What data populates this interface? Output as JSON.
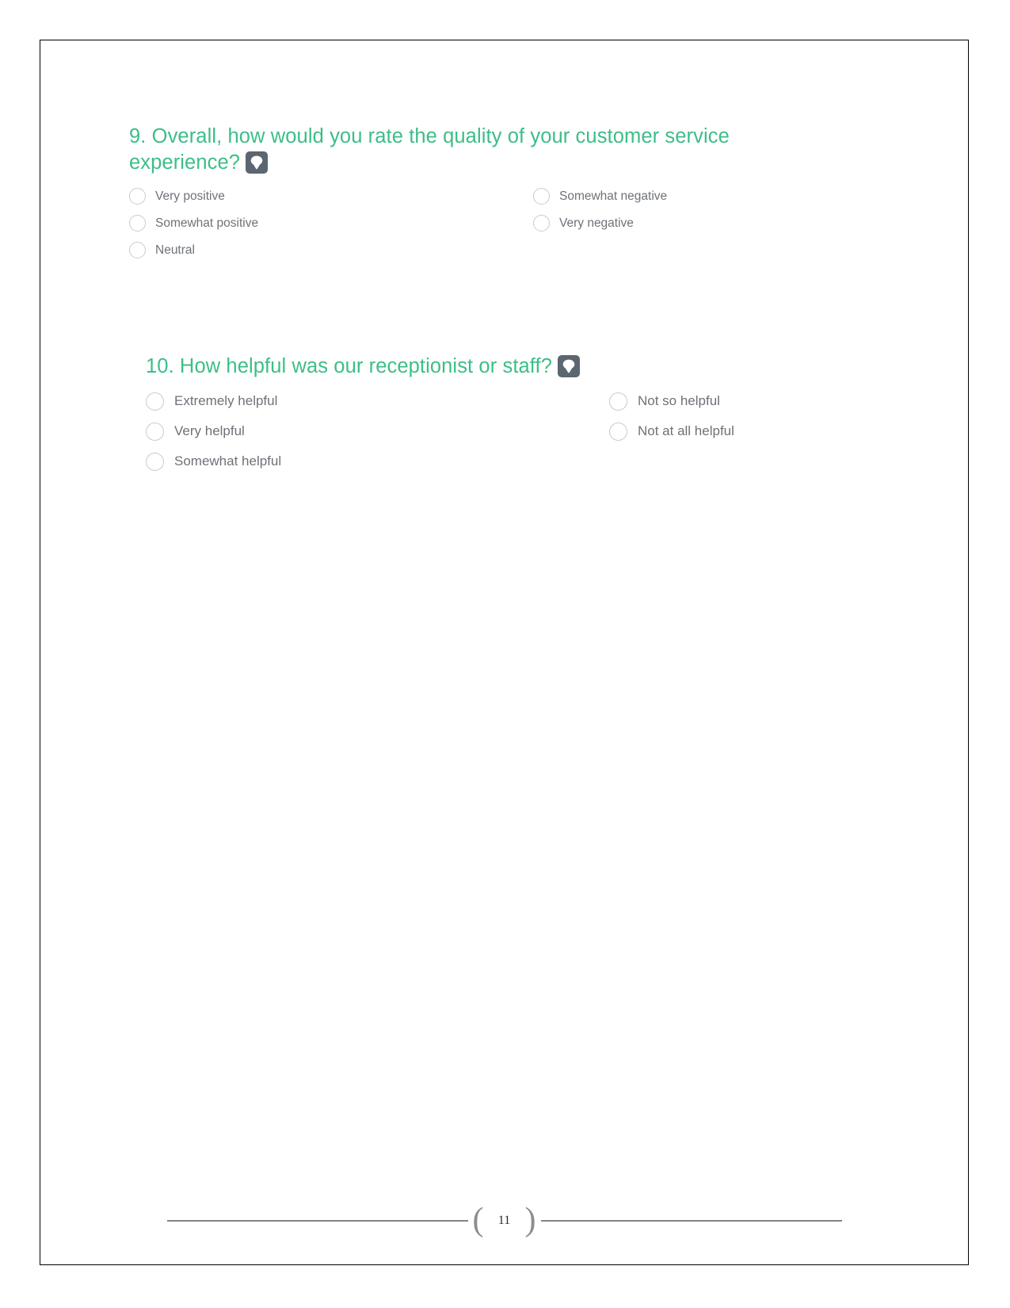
{
  "document": {
    "page_number": "11"
  },
  "questions": [
    {
      "number": "9.",
      "text": "9. Overall, how would you rate the quality of your customer service experience?",
      "icon": "comment-icon",
      "options_left": [
        {
          "label": "Very positive"
        },
        {
          "label": "Somewhat positive"
        },
        {
          "label": "Neutral"
        }
      ],
      "options_right": [
        {
          "label": "Somewhat negative"
        },
        {
          "label": "Very negative"
        }
      ]
    },
    {
      "number": "10.",
      "text": "10. How helpful was our receptionist or staff?",
      "icon": "comment-icon",
      "options_left": [
        {
          "label": "Extremely helpful"
        },
        {
          "label": "Very helpful"
        },
        {
          "label": "Somewhat helpful"
        }
      ],
      "options_right": [
        {
          "label": "Not so helpful"
        },
        {
          "label": "Not at all helpful"
        }
      ]
    }
  ],
  "colors": {
    "heading_green": "#3cbe87",
    "option_text": "#6d7278",
    "radio_border": "#c9cbcd",
    "icon_background": "#5b6670",
    "footer_rule": "#848484",
    "page_border": "#000000"
  },
  "footer": {
    "brace_left": "(",
    "brace_right": ")"
  }
}
